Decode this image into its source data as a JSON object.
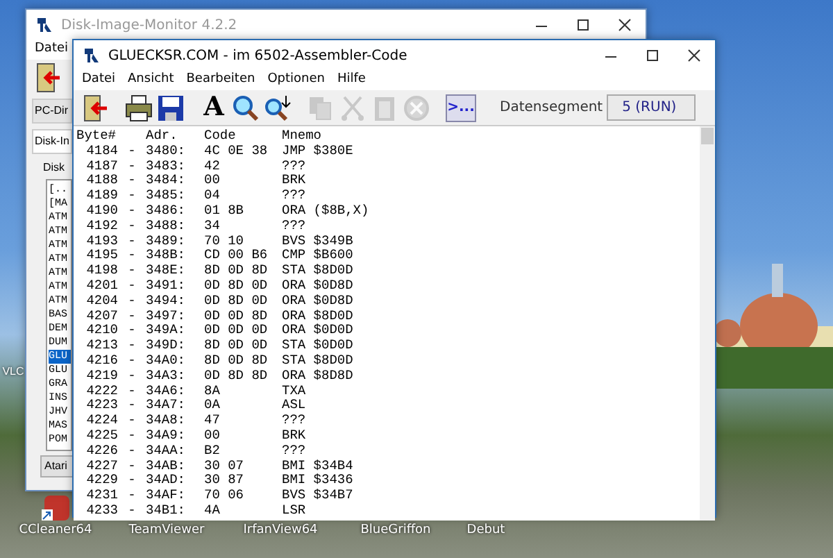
{
  "desktop": {
    "icons": [
      {
        "label": "VLC"
      },
      {
        "label": "CCleaner64"
      },
      {
        "label": "TeamViewer"
      },
      {
        "label": "IrfanView64"
      },
      {
        "label": "BlueGriffon"
      },
      {
        "label": "Debut"
      }
    ]
  },
  "back_window": {
    "title": "Disk-Image-Monitor 4.2.2",
    "menu": [
      "Datei"
    ],
    "tabs": [
      {
        "label": "PC-Dir",
        "selected": false
      },
      {
        "label": "Disk-In",
        "selected": true
      }
    ],
    "group_label": "Disk",
    "files": [
      {
        "name": "[..",
        "selected": false
      },
      {
        "name": "[MA",
        "selected": false
      },
      {
        "name": "ATM",
        "selected": false
      },
      {
        "name": "ATM",
        "selected": false
      },
      {
        "name": "ATM",
        "selected": false
      },
      {
        "name": "ATM",
        "selected": false
      },
      {
        "name": "ATM",
        "selected": false
      },
      {
        "name": "ATM",
        "selected": false
      },
      {
        "name": "ATM",
        "selected": false
      },
      {
        "name": "BAS",
        "selected": false
      },
      {
        "name": "DEM",
        "selected": false
      },
      {
        "name": "DUM",
        "selected": false
      },
      {
        "name": "GLU",
        "selected": true
      },
      {
        "name": "GLU",
        "selected": false
      },
      {
        "name": "GRA",
        "selected": false
      },
      {
        "name": "INS",
        "selected": false
      },
      {
        "name": "JHV",
        "selected": false
      },
      {
        "name": "MAS",
        "selected": false
      },
      {
        "name": "POM",
        "selected": false
      }
    ],
    "button": "Atari"
  },
  "window": {
    "title": "GLUECKSR.COM - im 6502-Assembler-Code",
    "menu": [
      "Datei",
      "Ansicht",
      "Bearbeiten",
      "Optionen",
      "Hilfe"
    ],
    "toolbar": [
      {
        "kind": "exit",
        "disabled": false
      },
      {
        "kind": "print",
        "disabled": false
      },
      {
        "kind": "save",
        "disabled": false
      },
      {
        "kind": "font",
        "label": "A",
        "disabled": false
      },
      {
        "kind": "search",
        "disabled": false
      },
      {
        "kind": "search_next",
        "disabled": false
      },
      {
        "kind": "copy",
        "disabled": true
      },
      {
        "kind": "cut",
        "disabled": true
      },
      {
        "kind": "paste",
        "disabled": true
      },
      {
        "kind": "cancel",
        "disabled": true
      },
      {
        "kind": "console",
        "label": ">...",
        "disabled": false
      }
    ],
    "segment_label": "Datensegment",
    "segment_value": "5 (RUN)",
    "columns": [
      "Byte#",
      "Adr.",
      "Code",
      "Mnemo"
    ],
    "rows": [
      {
        "byte": "4184",
        "sep": "-",
        "adr": "3480:",
        "code": "4C 0E 38",
        "mnemo": "JMP $380E"
      },
      {
        "byte": "4187",
        "sep": "-",
        "adr": "3483:",
        "code": "42",
        "mnemo": "???"
      },
      {
        "byte": "4188",
        "sep": "-",
        "adr": "3484:",
        "code": "00",
        "mnemo": "BRK"
      },
      {
        "byte": "4189",
        "sep": "-",
        "adr": "3485:",
        "code": "04",
        "mnemo": "???"
      },
      {
        "byte": "4190",
        "sep": "-",
        "adr": "3486:",
        "code": "01 8B",
        "mnemo": "ORA ($8B,X)"
      },
      {
        "byte": "4192",
        "sep": "-",
        "adr": "3488:",
        "code": "34",
        "mnemo": "???"
      },
      {
        "byte": "4193",
        "sep": "-",
        "adr": "3489:",
        "code": "70 10",
        "mnemo": "BVS $349B"
      },
      {
        "byte": "4195",
        "sep": "-",
        "adr": "348B:",
        "code": "CD 00 B6",
        "mnemo": "CMP $B600"
      },
      {
        "byte": "4198",
        "sep": "-",
        "adr": "348E:",
        "code": "8D 0D 8D",
        "mnemo": "STA $8D0D"
      },
      {
        "byte": "4201",
        "sep": "-",
        "adr": "3491:",
        "code": "0D 8D 0D",
        "mnemo": "ORA $0D8D"
      },
      {
        "byte": "4204",
        "sep": "-",
        "adr": "3494:",
        "code": "0D 8D 0D",
        "mnemo": "ORA $0D8D"
      },
      {
        "byte": "4207",
        "sep": "-",
        "adr": "3497:",
        "code": "0D 0D 8D",
        "mnemo": "ORA $8D0D"
      },
      {
        "byte": "4210",
        "sep": "-",
        "adr": "349A:",
        "code": "0D 0D 0D",
        "mnemo": "ORA $0D0D"
      },
      {
        "byte": "4213",
        "sep": "-",
        "adr": "349D:",
        "code": "8D 0D 0D",
        "mnemo": "STA $0D0D"
      },
      {
        "byte": "4216",
        "sep": "-",
        "adr": "34A0:",
        "code": "8D 0D 8D",
        "mnemo": "STA $8D0D"
      },
      {
        "byte": "4219",
        "sep": "-",
        "adr": "34A3:",
        "code": "0D 8D 8D",
        "mnemo": "ORA $8D8D"
      },
      {
        "byte": "4222",
        "sep": "-",
        "adr": "34A6:",
        "code": "8A",
        "mnemo": "TXA"
      },
      {
        "byte": "4223",
        "sep": "-",
        "adr": "34A7:",
        "code": "0A",
        "mnemo": "ASL"
      },
      {
        "byte": "4224",
        "sep": "-",
        "adr": "34A8:",
        "code": "47",
        "mnemo": "???"
      },
      {
        "byte": "4225",
        "sep": "-",
        "adr": "34A9:",
        "code": "00",
        "mnemo": "BRK"
      },
      {
        "byte": "4226",
        "sep": "-",
        "adr": "34AA:",
        "code": "B2",
        "mnemo": "???"
      },
      {
        "byte": "4227",
        "sep": "-",
        "adr": "34AB:",
        "code": "30 07",
        "mnemo": "BMI $34B4"
      },
      {
        "byte": "4229",
        "sep": "-",
        "adr": "34AD:",
        "code": "30 87",
        "mnemo": "BMI $3436"
      },
      {
        "byte": "4231",
        "sep": "-",
        "adr": "34AF:",
        "code": "70 06",
        "mnemo": "BVS $34B7"
      },
      {
        "byte": "4233",
        "sep": "-",
        "adr": "34B1:",
        "code": "4A",
        "mnemo": "LSR"
      }
    ]
  }
}
